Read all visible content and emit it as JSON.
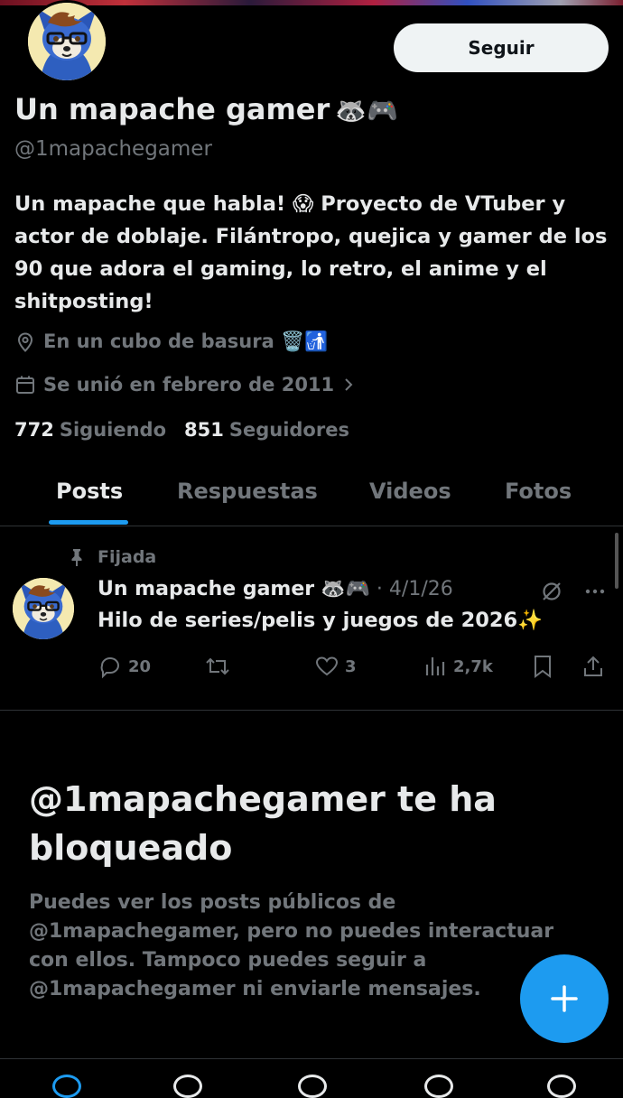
{
  "profile": {
    "name": "Un mapache gamer",
    "name_emoji": "🦝🎮",
    "handle": "@1mapachegamer",
    "bio": "Un mapache que habla! 😱 Proyecto de VTuber y actor de doblaje. Filántropo, quejica y gamer de los 90 que adora el gaming, lo retro, el anime y el shitposting!",
    "location": "En un cubo de basura 🗑️🚮",
    "joined": "Se unió en febrero de 2011",
    "following_count": "772",
    "following_label": "Siguiendo",
    "followers_count": "851",
    "followers_label": "Seguidores",
    "follow_button": "Seguir"
  },
  "tabs": [
    "Posts",
    "Respuestas",
    "Videos",
    "Fotos"
  ],
  "active_tab": "Posts",
  "pinned_post": {
    "pinned_label": "Fijada",
    "author": "Un mapache gamer",
    "author_emoji": "🦝🎮",
    "date": "· 4/1/26",
    "text": "Hilo de series/pelis y juegos de 2026✨",
    "replies": "20",
    "reposts": "",
    "likes": "3",
    "views": "2,7k"
  },
  "blocked": {
    "title": "@1mapachegamer te ha bloqueado",
    "body": "Puedes ver los posts públicos de @1mapachegamer, pero no puedes interactuar con ellos. Tampoco puedes seguir a @1mapachegamer ni enviarle mensajes."
  },
  "colors": {
    "accent": "#1d9bf0",
    "text_primary": "#e7e9ea",
    "text_secondary": "#71767b",
    "background": "#000000"
  },
  "icons": {
    "location": "location-pin-icon",
    "calendar": "calendar-icon",
    "pin": "pin-icon",
    "reply": "reply-icon",
    "repost": "repost-icon",
    "like": "heart-icon",
    "views": "views-bar-icon",
    "bookmark": "bookmark-icon",
    "share": "share-icon",
    "compose": "plus-icon"
  }
}
